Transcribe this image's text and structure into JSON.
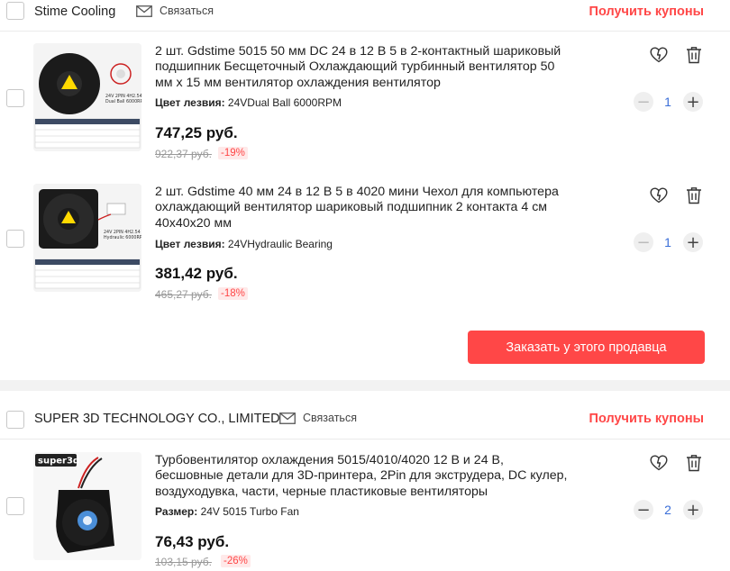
{
  "sellers": [
    {
      "name": "Stime Cooling",
      "contact_label": "Связаться",
      "coupons_label": "Получить купоны",
      "order_button": "Заказать у этого продавца",
      "items": [
        {
          "title": "2 шт. Gdstime 5015 50 мм DC 24 в 12 В 5 в 2-контактный шариковый подшипник Бесщеточный Охлаждающий турбинный вентилятор 50 мм x 15 мм вентилятор охлаждения вентилятор",
          "variant_label": "Цвет лезвия:",
          "variant_value": "24VDual Ball 6000RPM",
          "price": "747,25 руб.",
          "old_price": "922,37 руб.",
          "discount": "-19%",
          "quantity": "1",
          "thumb_caption": "24V 2PIN 4H2.54 Dual Ball 6000RPM"
        },
        {
          "title": "2 шт. Gdstime 40 мм 24 в 12 В 5 в 4020 мини Чехол для компьютера охлаждающий вентилятор шариковый подшипник 2 контакта 4 см 40x40x20 мм",
          "variant_label": "Цвет лезвия:",
          "variant_value": "24VHydraulic Bearing",
          "price": "381,42 руб.",
          "old_price": "465,27 руб.",
          "discount": "-18%",
          "quantity": "1",
          "thumb_caption": "24V 2PIN 4H2.54 Hydraulic 6000RPM"
        }
      ]
    },
    {
      "name": "SUPER 3D TECHNOLOGY CO., LIMITED",
      "contact_label": "Связаться",
      "coupons_label": "Получить купоны",
      "items": [
        {
          "title": "Турбовентилятор охлаждения 5015/4010/4020 12 В и 24 В, бесшовные детали для 3D-принтера, 2Pin для экструдера, DC кулер, воздуходувка, части, черные пластиковые вентиляторы",
          "variant_label": "Размер:",
          "variant_value": "24V 5015 Turbo Fan",
          "price": "76,43 руб.",
          "old_price": "103,15 руб.",
          "discount": "-26%",
          "quantity": "2",
          "thumb_caption": "super3d"
        }
      ]
    }
  ],
  "icons": {
    "contact": "mail-icon",
    "wishlist": "heart-icon",
    "delete": "trash-icon",
    "minus": "minus-icon",
    "plus": "plus-icon"
  },
  "colors": {
    "accent": "#ff4747",
    "quantity": "#3a6ed8"
  }
}
